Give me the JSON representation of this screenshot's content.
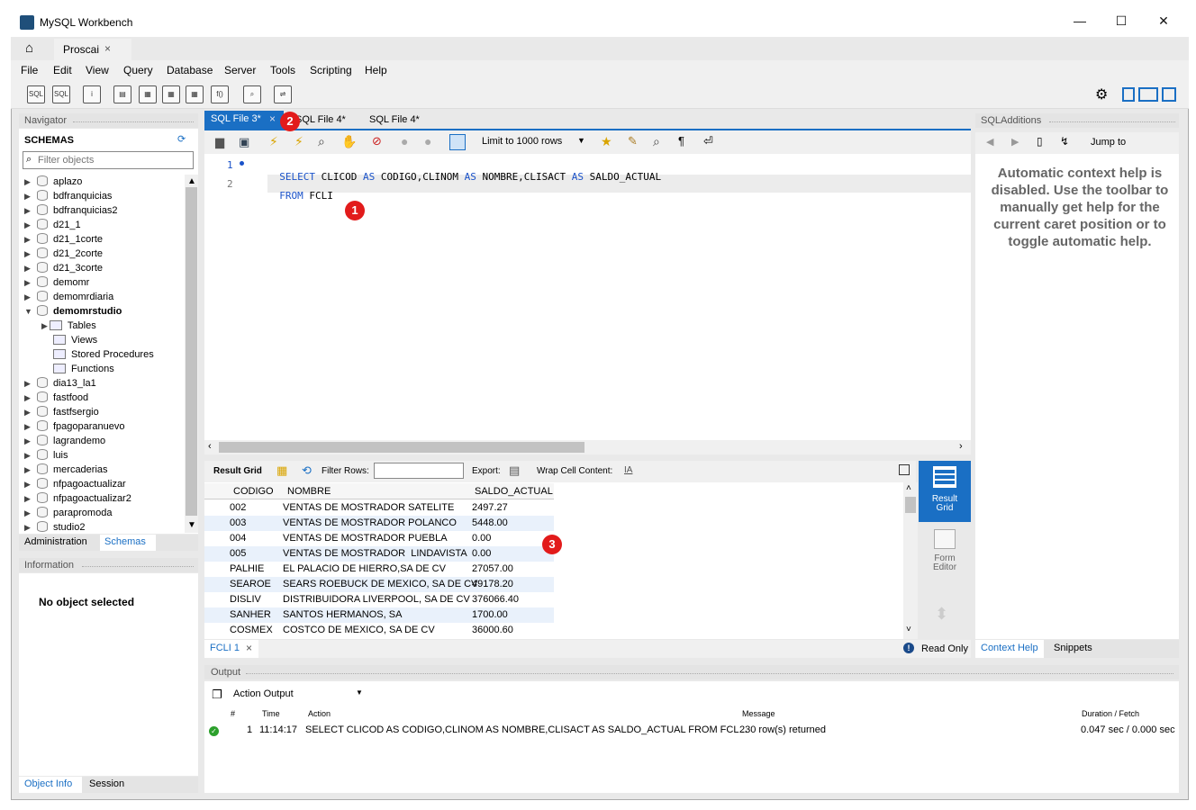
{
  "window": {
    "title": "MySQL Workbench",
    "minimize": "—",
    "maximize": "☐",
    "close": "✕"
  },
  "tabs": {
    "home_icon": "home-icon",
    "connection_tab": "Proscai",
    "close": "×"
  },
  "menu": [
    "File",
    "Edit",
    "View",
    "Query",
    "Database",
    "Server",
    "Tools",
    "Scripting",
    "Help"
  ],
  "navigator": {
    "title": "Navigator",
    "schemas_label": "SCHEMAS",
    "filter_placeholder": "Filter objects",
    "schemas": [
      "aplazo",
      "bdfranquicias",
      "bdfranquicias2",
      "d21_1",
      "d21_1corte",
      "d21_2corte",
      "d21_3corte",
      "demomr",
      "demomrdiaria",
      "demomrstudio",
      "dia13_la1",
      "fastfood",
      "fastfsergio",
      "fpagoparanuevo",
      "lagrandemo",
      "luis",
      "mercaderias",
      "nfpagoactualizar",
      "nfpagoactualizar2",
      "parapromoda",
      "studio2"
    ],
    "expanded_children": [
      "Tables",
      "Views",
      "Stored Procedures",
      "Functions"
    ],
    "bottom_tabs": [
      "Administration",
      "Schemas"
    ]
  },
  "information": {
    "title": "Information",
    "text": "No object selected",
    "tabs": [
      "Object Info",
      "Session"
    ]
  },
  "editor": {
    "tabs": [
      {
        "label": "SQL File 3*",
        "close": "×"
      },
      {
        "label": "SQL File 4*"
      },
      {
        "label": "SQL File 4*"
      }
    ],
    "limit_label": "Limit to 1000 rows",
    "lines": [
      {
        "num": "1",
        "tokens": [
          {
            "t": "SELECT",
            "k": true
          },
          {
            "t": " CLICOD ",
            "k": false
          },
          {
            "t": "AS",
            "k": true
          },
          {
            "t": " CODIGO,CLINOM ",
            "k": false
          },
          {
            "t": "AS",
            "k": true
          },
          {
            "t": " NOMBRE,CLISACT ",
            "k": false
          },
          {
            "t": "AS",
            "k": true
          },
          {
            "t": " SALDO_ACTUAL",
            "k": false
          }
        ]
      },
      {
        "num": "2",
        "tokens": [
          {
            "t": "FROM",
            "k": true
          },
          {
            "t": " FCLI",
            "k": false
          }
        ]
      }
    ]
  },
  "result_toolbar": {
    "result_grid": "Result Grid",
    "filter_rows": "Filter Rows:",
    "export": "Export:",
    "wrap": "Wrap Cell Content:"
  },
  "result": {
    "columns": [
      "CODIGO",
      "NOMBRE",
      "SALDO_ACTUAL"
    ],
    "rows": [
      [
        "002",
        "VENTAS DE MOSTRADOR SATELITE",
        "2497.27"
      ],
      [
        "003",
        "VENTAS DE MOSTRADOR POLANCO",
        "5448.00"
      ],
      [
        "004",
        "VENTAS DE MOSTRADOR PUEBLA",
        "0.00"
      ],
      [
        "005",
        "VENTAS DE MOSTRADOR  LINDAVISTA",
        "0.00"
      ],
      [
        "PALHIE",
        "EL PALACIO DE HIERRO,SA DE CV",
        "27057.00"
      ],
      [
        "SEAROE",
        "SEARS ROEBUCK DE MEXICO, SA DE CV",
        "49178.20"
      ],
      [
        "DISLIV",
        "DISTRIBUIDORA LIVERPOOL, SA DE CV",
        "376066.40"
      ],
      [
        "SANHER",
        "SANTOS HERMANOS, SA",
        "1700.00"
      ],
      [
        "COSMEX",
        "COSTCO DE MEXICO, SA DE CV",
        "36000.60"
      ]
    ],
    "tab_label": "FCLI 1",
    "read_only": "Read Only",
    "side_buttons": [
      "Result Grid",
      "Form Editor"
    ]
  },
  "sqladditions": {
    "title": "SQLAdditions",
    "jump_to": "Jump to",
    "help_text": "Automatic context help is disabled. Use the toolbar to manually get help for the current caret position or to toggle automatic help.",
    "tabs": [
      "Context Help",
      "Snippets"
    ]
  },
  "output": {
    "title": "Output",
    "selector": "Action Output",
    "columns": [
      "#",
      "Time",
      "Action",
      "Message",
      "Duration / Fetch"
    ],
    "rows": [
      {
        "num": "1",
        "time": "11:14:17",
        "action": "SELECT CLICOD AS CODIGO,CLINOM AS NOMBRE,CLISACT AS SALDO_ACTUAL FROM FCL...",
        "message": "230 row(s) returned",
        "duration": "0.047 sec / 0.000 sec"
      }
    ]
  },
  "badges": [
    "1",
    "2",
    "3"
  ],
  "colors": {
    "accent": "#1a6fc4",
    "keyword": "#1a52c9",
    "badge": "#e21b1b",
    "success": "#2ca02c"
  }
}
